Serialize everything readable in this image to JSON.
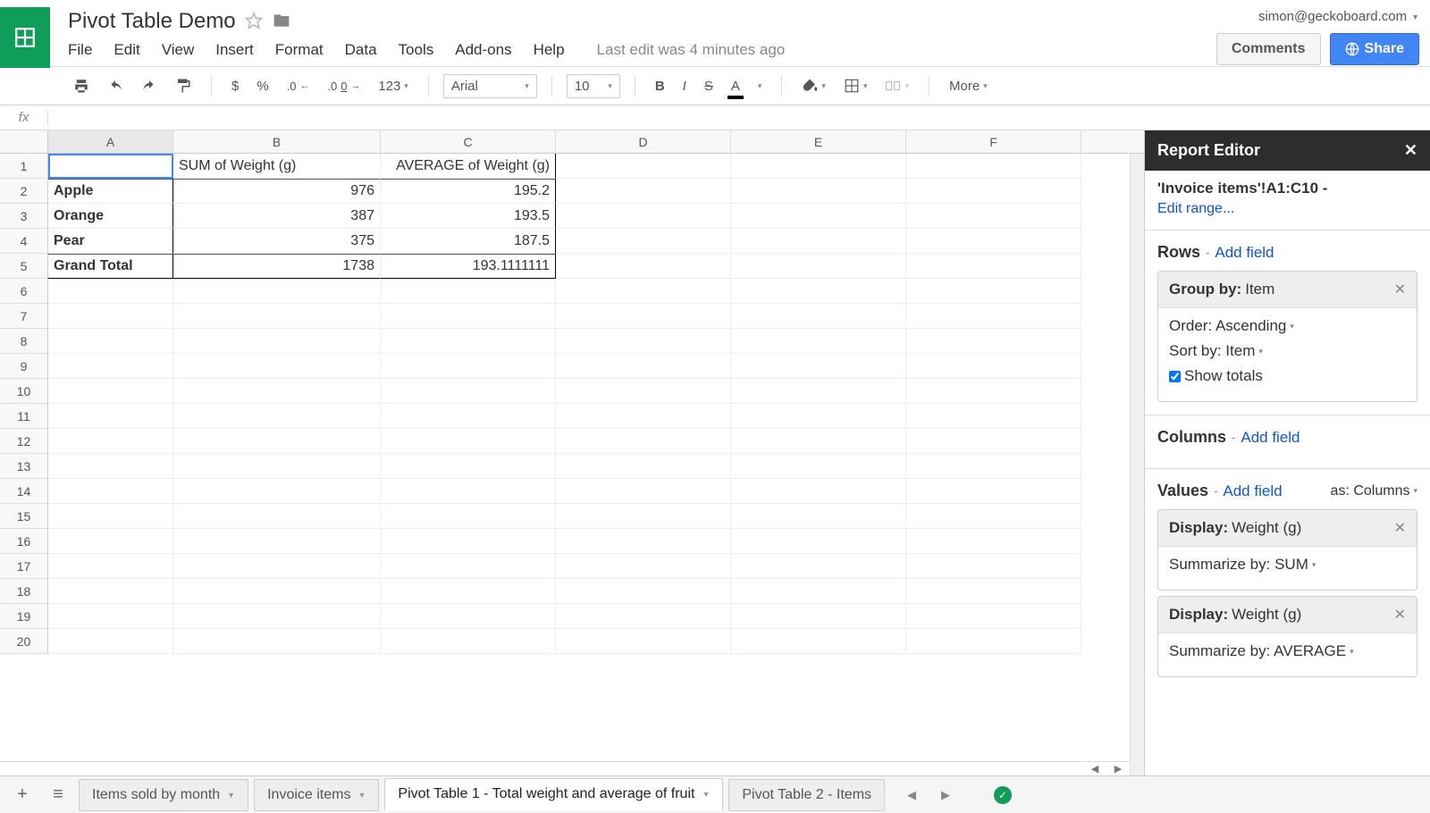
{
  "header": {
    "title": "Pivot Table Demo",
    "account": "simon@geckoboard.com",
    "comments_label": "Comments",
    "share_label": "Share",
    "last_edit": "Last edit was 4 minutes ago"
  },
  "menus": [
    "File",
    "Edit",
    "View",
    "Insert",
    "Format",
    "Data",
    "Tools",
    "Add-ons",
    "Help"
  ],
  "toolbar": {
    "currency": "$",
    "percent": "%",
    "dec_dec": ".0←",
    "inc_dec": ".00→",
    "numfmt": "123",
    "font": "Arial",
    "size": "10",
    "more": "More"
  },
  "columns": [
    "A",
    "B",
    "C",
    "D",
    "E",
    "F"
  ],
  "rows": [
    1,
    2,
    3,
    4,
    5,
    6,
    7,
    8,
    9,
    10,
    11,
    12,
    13,
    14,
    15,
    16,
    17,
    18,
    19,
    20
  ],
  "pivot": {
    "headers": [
      "",
      "SUM of Weight (g)",
      "AVERAGE of Weight (g)"
    ],
    "data": [
      {
        "label": "Apple",
        "sum": "976",
        "avg": "195.2"
      },
      {
        "label": "Orange",
        "sum": "387",
        "avg": "193.5"
      },
      {
        "label": "Pear",
        "sum": "375",
        "avg": "187.5"
      }
    ],
    "total": {
      "label": "Grand Total",
      "sum": "1738",
      "avg": "193.1111111"
    }
  },
  "editor": {
    "title": "Report Editor",
    "range": "'Invoice items'!A1:C10 -",
    "edit_range": "Edit range...",
    "rows_label": "Rows",
    "columns_label": "Columns",
    "values_label": "Values",
    "add_field": "Add field",
    "as_label": "as: Columns",
    "group": {
      "prefix": "Group by:",
      "value": "Item",
      "order": "Order: Ascending",
      "sortby": "Sort by: Item",
      "show_totals": "Show totals"
    },
    "val1": {
      "display_prefix": "Display:",
      "display_val": "Weight (g)",
      "sum": "Summarize by: SUM"
    },
    "val2": {
      "display_prefix": "Display:",
      "display_val": "Weight (g)",
      "sum": "Summarize by: AVERAGE"
    }
  },
  "tabs": {
    "t1": "Items sold by month",
    "t2": "Invoice items",
    "t3": "Pivot Table 1 - Total weight and average of fruit",
    "t4": "Pivot Table 2 - Items"
  }
}
